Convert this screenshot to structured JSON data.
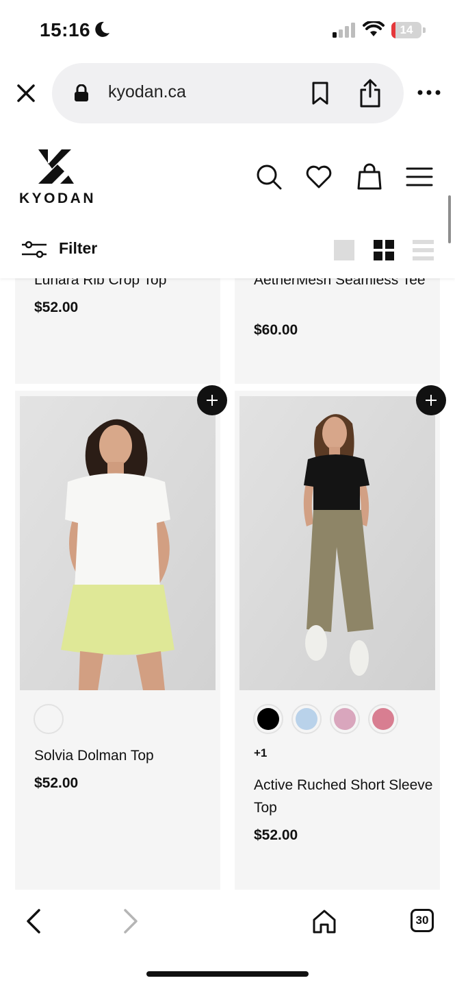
{
  "status_bar": {
    "time": "15:16",
    "battery_level": "14",
    "battery_percent": 14,
    "battery_color": "#e5383b"
  },
  "browser": {
    "url": "kyodan.ca",
    "tab_count": "30"
  },
  "site": {
    "logo_text": "KYODAN",
    "filter_label": "Filter",
    "active_view": "grid"
  },
  "products": [
    {
      "title": "Lunara Rib Crop Top",
      "price": "$52.00"
    },
    {
      "title": "AetherMesh Seamless Tee",
      "price": "$60.00"
    },
    {
      "title": "Solvia Dolman Top",
      "price": "$52.00",
      "swatches": [
        "#f5f5f5"
      ]
    },
    {
      "title": "Active Ruched Short Sleeve Top",
      "price": "$52.00",
      "swatches": [
        "#000000",
        "#b9d2ea",
        "#d9a6bd",
        "#d87e91"
      ],
      "more_colors": "+1"
    }
  ],
  "icons": {
    "close": "close-icon",
    "lock": "lock-icon",
    "bookmark": "bookmark-icon",
    "share": "share-icon",
    "more": "more-icon",
    "search": "search-icon",
    "wishlist": "heart-icon",
    "cart": "bag-icon",
    "menu": "hamburger-icon",
    "filter": "sliders-icon",
    "back": "chevron-left-icon",
    "forward": "chevron-right-icon",
    "home": "home-icon"
  }
}
